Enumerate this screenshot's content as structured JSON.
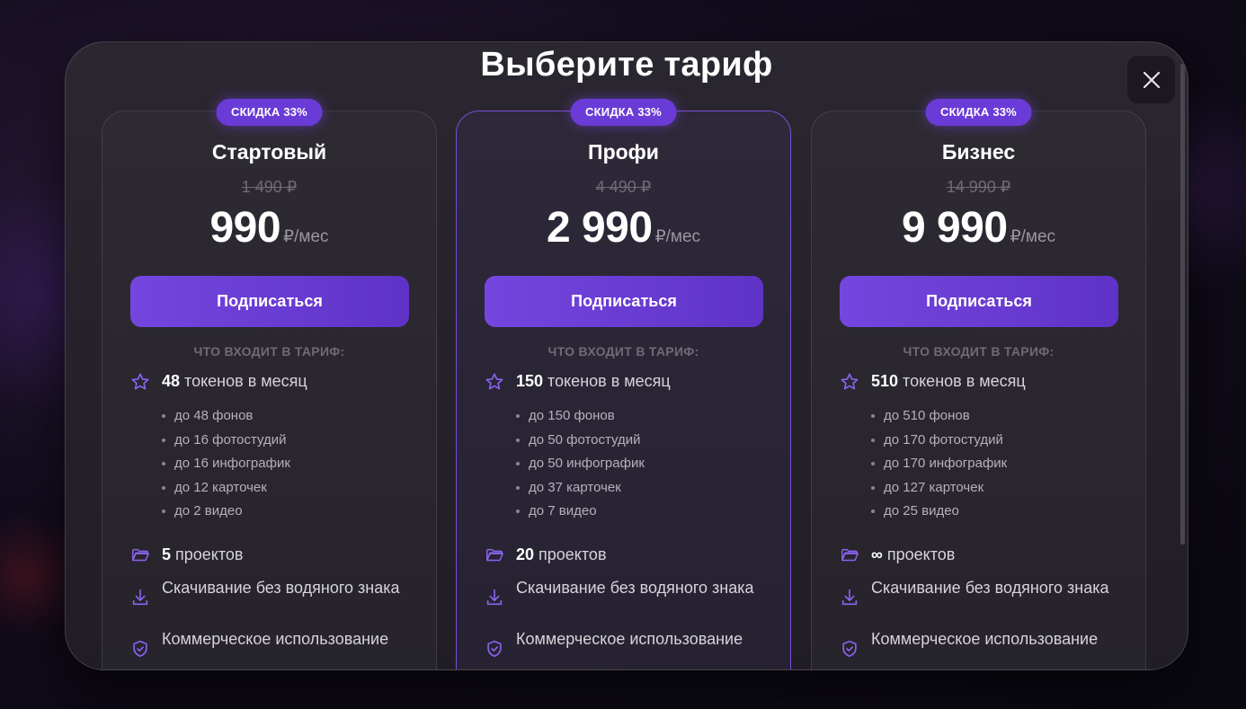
{
  "modal": {
    "title": "Выберите тариф",
    "close_icon": "close-icon"
  },
  "accent_color": "#6a3bd6",
  "plans": [
    {
      "badge": "СКИДКА 33%",
      "name": "Стартовый",
      "old_price": "1 490 ₽",
      "price": "990",
      "per": "₽/мес",
      "cta": "Подписаться",
      "included_label": "ЧТО ВХОДИТ В ТАРИФ:",
      "tokens_count": "48",
      "tokens_text": " токенов в месяц",
      "sub_items": [
        "до 48 фонов",
        "до 16 фотостудий",
        "до 16 инфографик",
        "до 12 карточек",
        "до 2 видео"
      ],
      "projects_count": "5",
      "projects_text": " проектов",
      "download_text": "Скачивание без водяного знака",
      "commercial_text": "Коммерческое использование",
      "featured": false
    },
    {
      "badge": "СКИДКА 33%",
      "name": "Профи",
      "old_price": "4 490 ₽",
      "price": "2 990",
      "per": "₽/мес",
      "cta": "Подписаться",
      "included_label": "ЧТО ВХОДИТ В ТАРИФ:",
      "tokens_count": "150",
      "tokens_text": " токенов в месяц",
      "sub_items": [
        "до 150 фонов",
        "до 50 фотостудий",
        "до 50 инфографик",
        "до 37 карточек",
        "до 7 видео"
      ],
      "projects_count": "20",
      "projects_text": " проектов",
      "download_text": "Скачивание без водяного знака",
      "commercial_text": "Коммерческое использование",
      "featured": true
    },
    {
      "badge": "СКИДКА 33%",
      "name": "Бизнес",
      "old_price": "14 990 ₽",
      "price": "9 990",
      "per": "₽/мес",
      "cta": "Подписаться",
      "included_label": "ЧТО ВХОДИТ В ТАРИФ:",
      "tokens_count": "510",
      "tokens_text": " токенов в месяц",
      "sub_items": [
        "до 510 фонов",
        "до 170 фотостудий",
        "до 170 инфографик",
        "до 127 карточек",
        "до 25 видео"
      ],
      "projects_count": "∞",
      "projects_text": " проектов",
      "download_text": "Скачивание без водяного знака",
      "commercial_text": "Коммерческое использование",
      "featured": false
    }
  ]
}
